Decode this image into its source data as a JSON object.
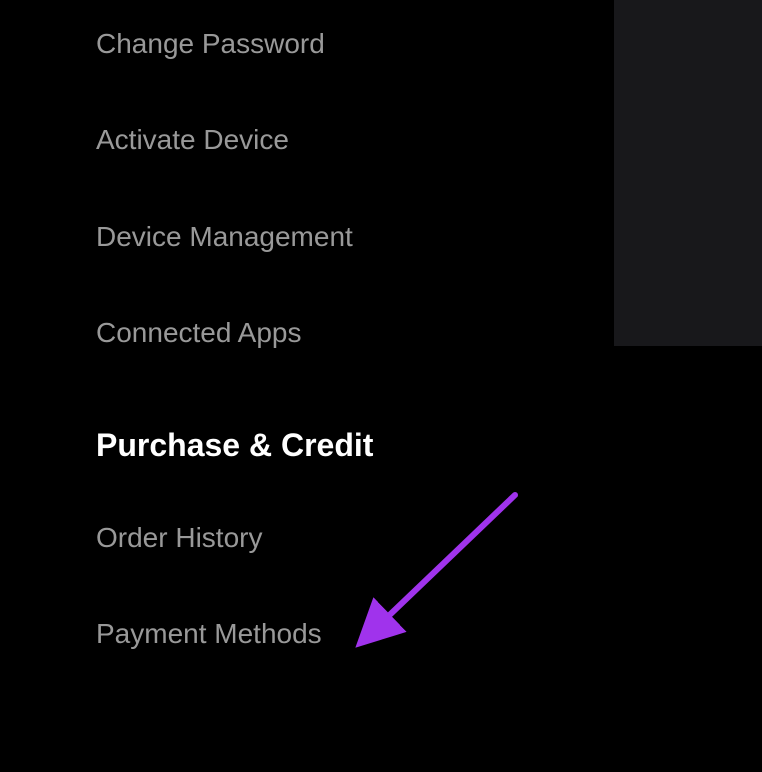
{
  "sidebar": {
    "items": [
      {
        "label": "Change Password"
      },
      {
        "label": "Activate Device"
      },
      {
        "label": "Device Management"
      },
      {
        "label": "Connected Apps"
      }
    ]
  },
  "section": {
    "title": "Purchase & Credit",
    "items": [
      {
        "label": "Order History"
      },
      {
        "label": "Payment Methods"
      }
    ]
  },
  "annotation": {
    "arrow_color": "#a033ec"
  }
}
